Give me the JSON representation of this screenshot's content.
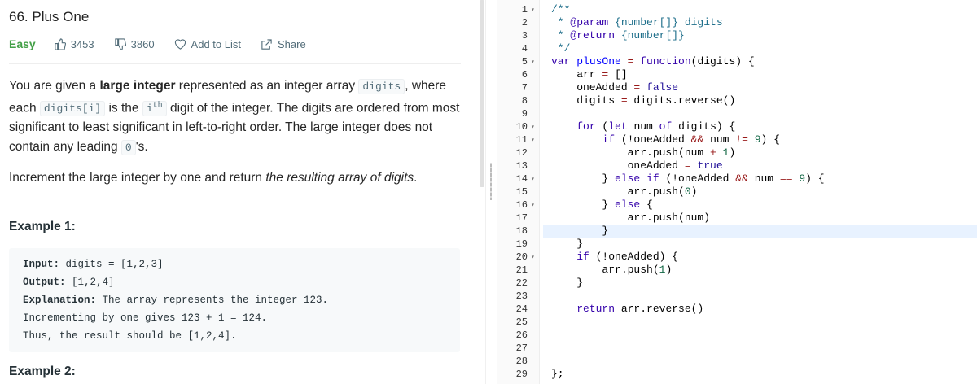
{
  "problem": {
    "title": "66. Plus One",
    "difficulty": "Easy",
    "likes": "3453",
    "dislikes": "3860",
    "add_to_list": "Add to List",
    "share": "Share",
    "colors": {
      "easy": "#43a047",
      "meta": "#546e7a"
    }
  },
  "description": {
    "p1_a": "You are given a ",
    "p1_b": "large integer",
    "p1_c": " represented as an integer array ",
    "p1_code1": "digits",
    "p1_d": ", where each ",
    "p1_code2": "digits[i]",
    "p1_e": " is the ",
    "p1_code3": "i",
    "p1_sup": "th",
    "p1_f": " digit of the integer. The digits are ordered from most significant to least significant in left-to-right order. The large integer does not contain any leading ",
    "p1_code4": "0",
    "p1_g": "'s.",
    "p2_a": "Increment the large integer by one and return ",
    "p2_i": "the resulting array of digits",
    "p2_b": "."
  },
  "example1": {
    "heading": "Example 1:",
    "input_label": "Input:",
    "input_value": " digits = [1,2,3]",
    "output_label": "Output:",
    "output_value": " [1,2,4]",
    "explanation_label": "Explanation:",
    "explanation_value": " The array represents the integer 123.",
    "line4": "Incrementing by one gives 123 + 1 = 124.",
    "line5": "Thus, the result should be [1,2,4]."
  },
  "example2": {
    "heading": "Example 2:"
  },
  "editor": {
    "active_line": 18,
    "lines": [
      {
        "n": "1",
        "fold": true
      },
      {
        "n": "2"
      },
      {
        "n": "3"
      },
      {
        "n": "4"
      },
      {
        "n": "5",
        "fold": true
      },
      {
        "n": "6"
      },
      {
        "n": "7"
      },
      {
        "n": "8"
      },
      {
        "n": "9"
      },
      {
        "n": "10",
        "fold": true
      },
      {
        "n": "11",
        "fold": true
      },
      {
        "n": "12"
      },
      {
        "n": "13"
      },
      {
        "n": "14",
        "fold": true
      },
      {
        "n": "15"
      },
      {
        "n": "16",
        "fold": true
      },
      {
        "n": "17"
      },
      {
        "n": "18"
      },
      {
        "n": "19"
      },
      {
        "n": "20",
        "fold": true
      },
      {
        "n": "21"
      },
      {
        "n": "22"
      },
      {
        "n": "23"
      },
      {
        "n": "24"
      },
      {
        "n": "25"
      },
      {
        "n": "26"
      },
      {
        "n": "27"
      },
      {
        "n": "28"
      },
      {
        "n": "29"
      }
    ],
    "code": [
      "/**",
      " * @param {number[]} digits",
      " * @return {number[]}",
      " */",
      "var plusOne = function(digits) {",
      "    arr = []",
      "    oneAdded = false",
      "    digits = digits.reverse()",
      "",
      "    for (let num of digits) {",
      "        if (!oneAdded && num != 9) {",
      "            arr.push(num + 1)",
      "            oneAdded = true",
      "        } else if (!oneAdded && num == 9) {",
      "            arr.push(0)",
      "        } else {",
      "            arr.push(num)",
      "        }",
      "    }",
      "    if (!oneAdded) {",
      "        arr.push(1)",
      "    }",
      "",
      "    return arr.reverse()",
      "",
      "",
      "",
      "",
      "};"
    ]
  }
}
